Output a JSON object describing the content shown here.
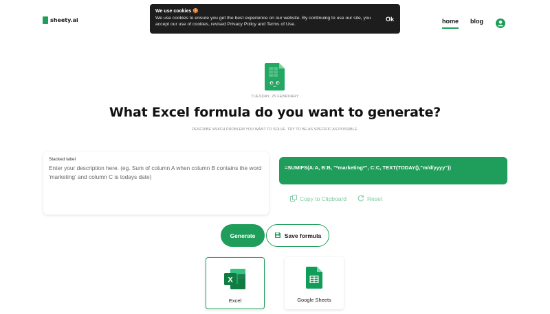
{
  "brand": {
    "name": "sheety.ai"
  },
  "nav": {
    "home": "home",
    "blog": "blog"
  },
  "cookie": {
    "title": "We use cookies 🍪",
    "text": "We use cookies to ensure you get the best experience on our website. By continuing to use our site, you accept our use of cookies, revised Privacy Policy and Terms of Use.",
    "ok": "Ok"
  },
  "hero": {
    "date": "TUESDAY, 25 FEBRUARY",
    "headline": "What Excel formula do you want to generate?",
    "subtitle": "DESCRIBE WHICH PROBLEM YOU WANT TO SOLVE. TRY TO BE AS SPECIFIC AS POSSIBLE."
  },
  "input": {
    "label": "Stacked label",
    "placeholder": "Enter your description here. (eg. Sum of column A when column B contains the word 'marketing' and column C is todays date)"
  },
  "output": {
    "formula": "=SUMIFS(A:A, B:B, \"*marketing*\", C:C, TEXT(TODAY(),\"m/d/yyyy\"))",
    "copy": "Copy to Clipboard",
    "reset": "Reset"
  },
  "buttons": {
    "generate": "Generate",
    "save": "Save formula"
  },
  "apps": {
    "excel": "Excel",
    "sheets": "Google Sheets",
    "selected": "Excel"
  },
  "colors": {
    "accent": "#1e9e5a",
    "banner": "#1d1d1d"
  }
}
